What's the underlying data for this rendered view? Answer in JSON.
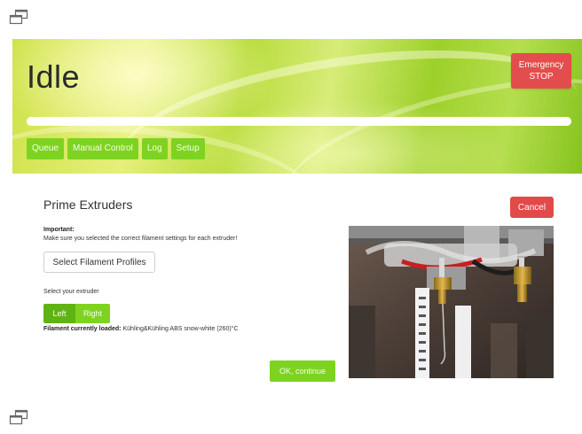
{
  "status": {
    "state": "Idle",
    "progress_percent": 100
  },
  "emergency": {
    "line1": "Emergency",
    "line2": "STOP"
  },
  "nav": {
    "tabs": [
      "Queue",
      "Manual Control",
      "Log",
      "Setup"
    ]
  },
  "dialog": {
    "title": "Prime Extruders",
    "cancel_label": "Cancel",
    "important_label": "Important:",
    "important_text": "Make sure you selected the correct filament settings for each extruder!",
    "select_profiles_label": "Select Filament Profiles",
    "select_extruder_label": "Select your extruder",
    "extruders": [
      "Left",
      "Right"
    ],
    "selected_extruder": "Left",
    "filament_loaded_label": "Filament currently loaded:",
    "filament_loaded_value": "Kühling&Kühling ABS snow-white (260)°C",
    "ok_label": "OK, continue"
  },
  "colors": {
    "accent_green": "#7ed321",
    "danger_red": "#e44d4d"
  },
  "icons": {
    "window": "restore-window-icon"
  }
}
